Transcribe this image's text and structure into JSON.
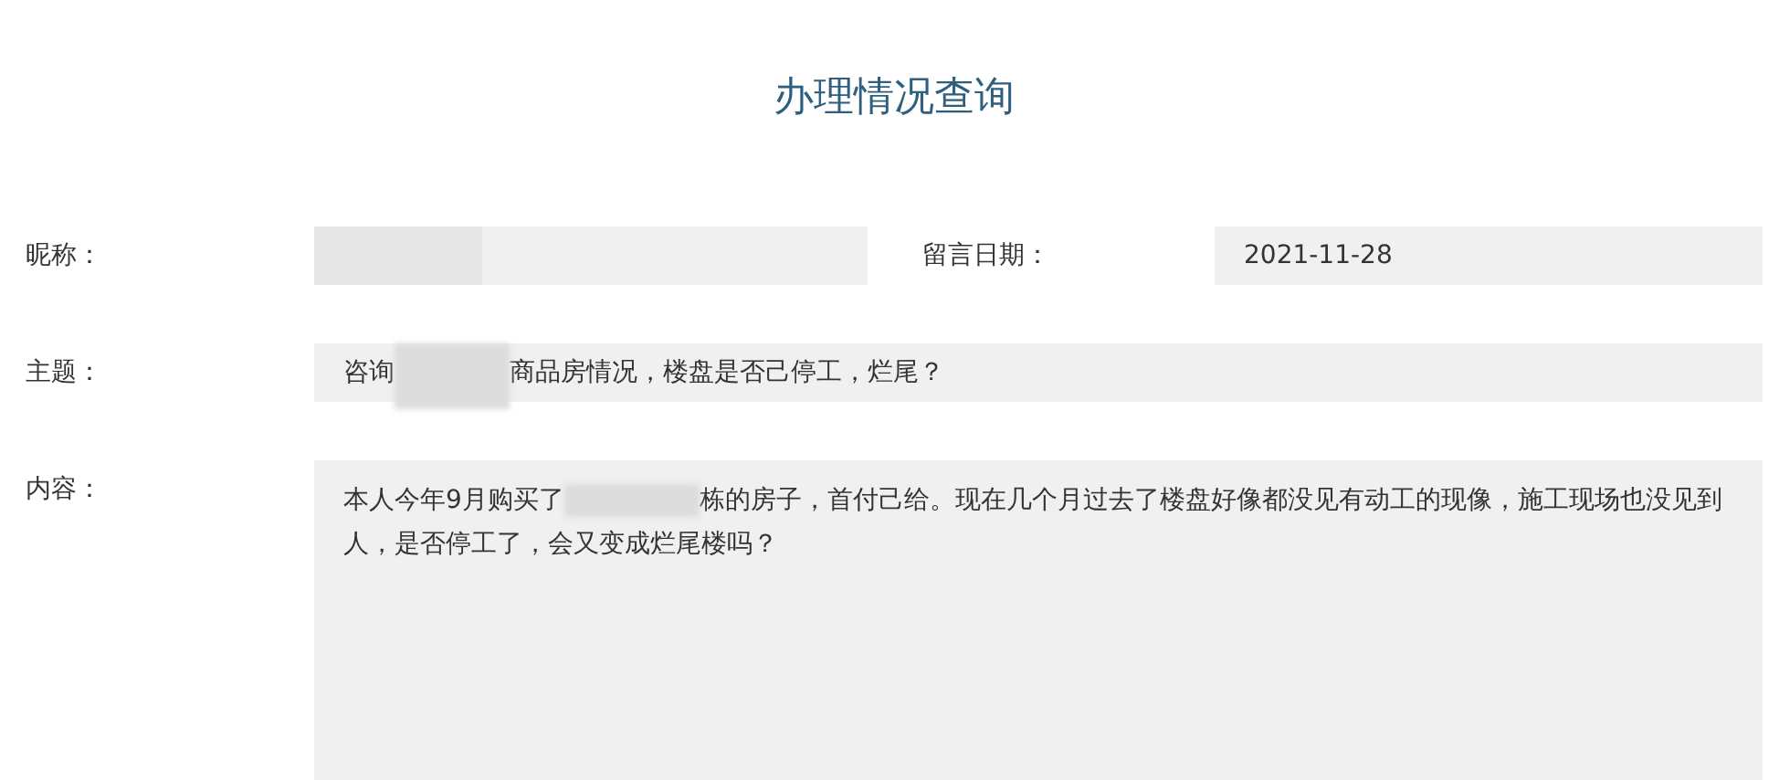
{
  "title": "办理情况查询",
  "nickname": {
    "label": "昵称：",
    "parts": [
      {
        "kind": "redacted"
      }
    ]
  },
  "date": {
    "label": "留言日期：",
    "value": "2021-11-28"
  },
  "subject": {
    "label": "主题：",
    "parts": [
      {
        "kind": "text",
        "text": "咨询"
      },
      {
        "kind": "redacted"
      },
      {
        "kind": "text",
        "text": "商品房情况，楼盘是否己停工，烂尾？"
      }
    ]
  },
  "content": {
    "label": "内容：",
    "parts": [
      {
        "kind": "text",
        "text": "本人今年9月购买了"
      },
      {
        "kind": "redacted"
      },
      {
        "kind": "text",
        "text": "栋的房子，首付己给。现在几个月过去了楼盘好像都没见有动工的现像，施工现场也没见到人，是否停工了，会又变成烂尾楼吗？"
      }
    ]
  }
}
